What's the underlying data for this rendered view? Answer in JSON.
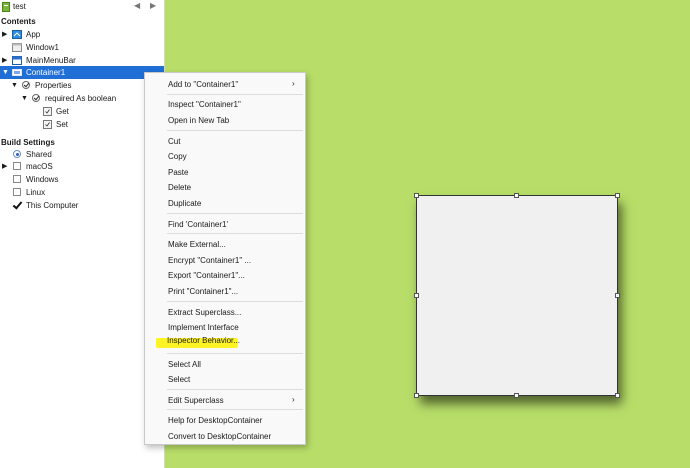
{
  "project": {
    "name": "test",
    "back_arrow": "◀",
    "forward_arrow": "▶"
  },
  "contents": {
    "heading": "Contents",
    "items": [
      {
        "label": "App",
        "icon": "app-icon"
      },
      {
        "label": "Window1",
        "icon": "window-icon"
      },
      {
        "label": "MainMenuBar",
        "icon": "menubar-icon"
      },
      {
        "label": "Container1",
        "icon": "container-icon",
        "selected": true
      },
      {
        "label": "Properties",
        "icon": "check-icon"
      },
      {
        "label": "required As boolean",
        "icon": "check-icon"
      },
      {
        "label": "Get",
        "icon": "method-icon"
      },
      {
        "label": "Set",
        "icon": "method-icon"
      }
    ]
  },
  "build_settings": {
    "heading": "Build Settings",
    "items": [
      {
        "label": "Shared",
        "control": "radio-selected"
      },
      {
        "label": "macOS",
        "control": "checkbox",
        "checked": false
      },
      {
        "label": "Windows",
        "control": "checkbox",
        "checked": false
      },
      {
        "label": "Linux",
        "control": "checkbox",
        "checked": false
      },
      {
        "label": "This Computer",
        "control": "checkbox",
        "checked": true
      }
    ]
  },
  "context_menu": {
    "add_to": "Add to \"Container1\"",
    "inspect": "Inspect \"Container1\"",
    "open_new_tab": "Open in New Tab",
    "cut": "Cut",
    "copy": "Copy",
    "paste": "Paste",
    "delete": "Delete",
    "duplicate": "Duplicate",
    "find": "Find 'Container1'",
    "make_external": "Make External...",
    "encrypt": "Encrypt \"Container1\"  ...",
    "export": "Export \"Container1\"...",
    "print": "Print \"Container1\"...",
    "extract_superclass": "Extract Superclass...",
    "implement_interface": "Implement Interface",
    "inspector_behavior": "Inspector Behavior...",
    "select_all": "Select All",
    "select": "Select",
    "edit_superclass": "Edit Superclass",
    "help": "Help for DesktopContainer",
    "convert": "Convert to DesktopContainer",
    "submenu_arrow": "›",
    "highlight_color": "#fff200"
  },
  "colors": {
    "canvas_bg": "#b8de69",
    "selection": "#1f6fd6"
  }
}
